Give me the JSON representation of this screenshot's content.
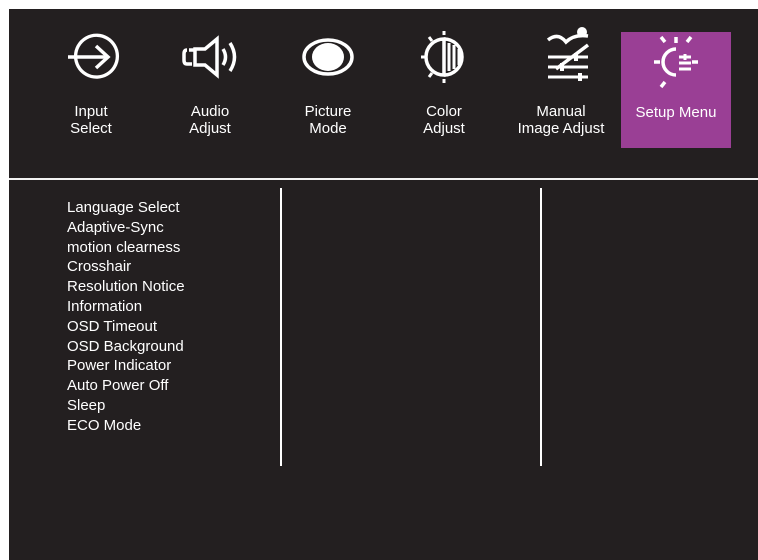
{
  "tabs": [
    {
      "line1": "Input",
      "line2": "Select",
      "icon": "input-select-icon"
    },
    {
      "line1": "Audio",
      "line2": "Adjust",
      "icon": "speaker-icon"
    },
    {
      "line1": "Picture",
      "line2": "Mode",
      "icon": "picture-mode-icon"
    },
    {
      "line1": "Color",
      "line2": "Adjust",
      "icon": "color-adjust-icon"
    },
    {
      "line1": "Manual",
      "line2": "Image Adjust",
      "icon": "manual-image-adjust-icon"
    },
    {
      "line1": "Setup Menu",
      "line2": "",
      "icon": "setup-sun-icon"
    }
  ],
  "active_tab": "Setup Menu",
  "menu_items": [
    "Language Select",
    "Adaptive-Sync",
    "motion clearness",
    "Crosshair",
    "Resolution Notice",
    "Information",
    "OSD Timeout",
    "OSD Background",
    "Power Indicator",
    "Auto Power Off",
    "Sleep",
    "ECO Mode"
  ],
  "colors": {
    "background": "#231f20",
    "accent": "#9a3f95",
    "text": "#ffffff"
  }
}
